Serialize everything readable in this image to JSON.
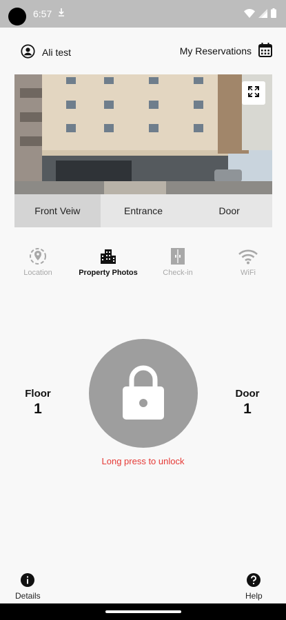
{
  "status_bar": {
    "time": "6:57"
  },
  "header": {
    "user_name": "Ali test",
    "reservations_label": "My Reservations"
  },
  "tabs": [
    {
      "label": "Front Veiw",
      "active": true
    },
    {
      "label": "Entrance",
      "active": false
    },
    {
      "label": "Door",
      "active": false
    }
  ],
  "actions": [
    {
      "label": "Location",
      "icon": "location-icon",
      "active": false
    },
    {
      "label": "Property Photos",
      "icon": "building-icon",
      "active": true
    },
    {
      "label": "Check-in",
      "icon": "door-icon",
      "active": false
    },
    {
      "label": "WiFi",
      "icon": "wifi-icon",
      "active": false
    }
  ],
  "floor": {
    "label": "Floor",
    "value": "1"
  },
  "door": {
    "label": "Door",
    "value": "1"
  },
  "lock": {
    "hint": "Long press to unlock",
    "hint_color": "#e53935",
    "button_color": "#9e9e9e"
  },
  "bottom": {
    "details_label": "Details",
    "help_label": "Help"
  }
}
